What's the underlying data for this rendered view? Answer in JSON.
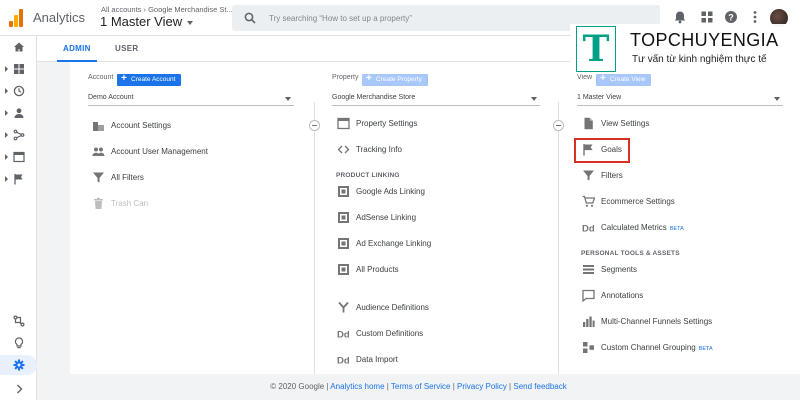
{
  "app": {
    "name": "Analytics",
    "breadcrumb": "All accounts › Google Merchandise St...",
    "view_title": "1 Master View"
  },
  "search": {
    "placeholder": "Try searching “How to set up a property”"
  },
  "tabs": [
    {
      "label": "ADMIN",
      "active": true
    },
    {
      "label": "USER",
      "active": false
    }
  ],
  "account": {
    "header": "Account",
    "create_label": "Create Account",
    "selected": "Demo Account",
    "items": [
      {
        "label": "Account Settings",
        "icon": "building-icon"
      },
      {
        "label": "Account User Management",
        "icon": "people-icon"
      },
      {
        "label": "All Filters",
        "icon": "filter-icon"
      },
      {
        "label": "Trash Can",
        "icon": "trash-icon",
        "disabled": true
      }
    ]
  },
  "property": {
    "header": "Property",
    "create_label": "Create Property",
    "selected": "Google Merchandise Store",
    "items": [
      {
        "label": "Property Settings",
        "icon": "window-icon"
      },
      {
        "label": "Tracking Info",
        "icon": "code-icon"
      }
    ],
    "section_label": "PRODUCT LINKING",
    "linking": [
      {
        "label": "Google Ads Linking",
        "icon": "link-grid-icon"
      },
      {
        "label": "AdSense Linking",
        "icon": "link-grid-icon"
      },
      {
        "label": "Ad Exchange Linking",
        "icon": "link-grid-icon"
      },
      {
        "label": "All Products",
        "icon": "link-grid-icon"
      }
    ],
    "more": [
      {
        "label": "Audience Definitions",
        "icon": "fork-icon"
      },
      {
        "label": "Custom Definitions",
        "icon": "dd-icon"
      },
      {
        "label": "Data Import",
        "icon": "dd-icon"
      }
    ]
  },
  "view": {
    "header": "View",
    "create_label": "Create View",
    "selected": "1 Master View",
    "items": [
      {
        "label": "View Settings",
        "icon": "document-icon"
      },
      {
        "label": "Goals",
        "icon": "flag-icon"
      },
      {
        "label": "Filters",
        "icon": "filter-icon"
      },
      {
        "label": "Ecommerce Settings",
        "icon": "cart-icon"
      },
      {
        "label": "Calculated Metrics",
        "icon": "dd-icon",
        "badge": "BETA"
      }
    ],
    "section_label": "PERSONAL TOOLS & ASSETS",
    "tools": [
      {
        "label": "Segments",
        "icon": "segments-icon"
      },
      {
        "label": "Annotations",
        "icon": "annotation-icon"
      },
      {
        "label": "Multi-Channel Funnels Settings",
        "icon": "bar-chart-icon"
      },
      {
        "label": "Custom Channel Grouping",
        "icon": "grouping-icon",
        "badge": "BETA"
      }
    ]
  },
  "footer": {
    "copyright": "© 2020 Google | ",
    "links": [
      "Analytics home",
      "Terms of Service",
      "Privacy Policy",
      "Send feedback"
    ],
    "sep": " | "
  },
  "watermark": {
    "logo_letter": "T",
    "brand": "TOPCHUYENGIA",
    "tagline": "Tư vấn từ kinh nghiệm thực tế"
  },
  "colors": {
    "accent": "#1a73e8",
    "highlight": "#d93025",
    "brand": "#00a087"
  }
}
